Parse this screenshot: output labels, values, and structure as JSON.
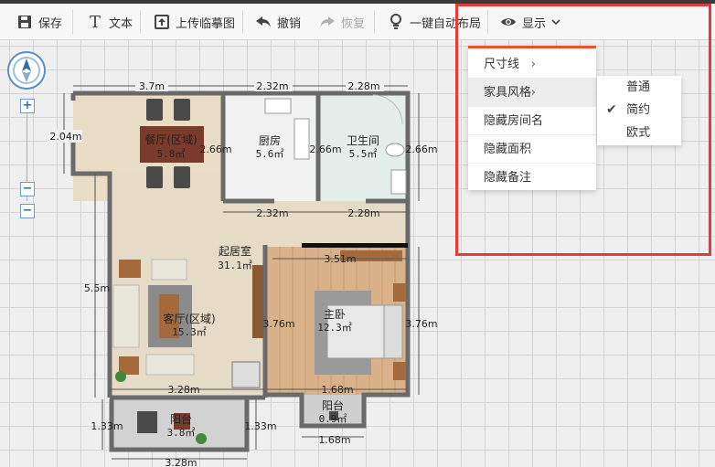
{
  "toolbar": {
    "save": "保存",
    "text": "文本",
    "upload": "上传临摹图",
    "undo": "撤销",
    "redo": "恢复",
    "auto_layout": "一键自动布局",
    "display": "显示"
  },
  "display_menu": {
    "items": [
      "尺寸线",
      "家具风格",
      "隐藏房间名",
      "隐藏面积",
      "隐藏备注"
    ],
    "style_submenu": [
      "普通",
      "简约",
      "欧式"
    ],
    "selected_style": "简约"
  },
  "rooms": [
    {
      "name": "餐厅(区域)",
      "area": "5.8㎡"
    },
    {
      "name": "厨房",
      "area": "5.6㎡"
    },
    {
      "name": "卫生间",
      "area": "5.5㎡"
    },
    {
      "name": "起居室",
      "area": "31.1㎡"
    },
    {
      "name": "客厅(区域)",
      "area": "15.3㎡"
    },
    {
      "name": "主卧",
      "area": "12.3㎡"
    },
    {
      "name": "阳台",
      "area": "0.9㎡"
    },
    {
      "name": "阳台",
      "area": "3.8㎡"
    }
  ],
  "dimensions": {
    "top_dining": "3.7m",
    "top_kitchen": "2.32m",
    "top_bath": "2.28m",
    "left_dining": "2.04m",
    "dining_kitchen": "2.66m",
    "kitchen_bath": "2.66m",
    "right_bath": "2.66m",
    "mid_kitchen": "2.32m",
    "mid_bath": "2.28m",
    "bedroom_top": "3.51m",
    "left_main": "5.5m",
    "living_bedroom": "3.76m",
    "right_bedroom": "3.76m",
    "bottom_living": "3.28m",
    "bottom_bedroom": "1.68m",
    "balcony_left": "1.33m",
    "balcony_right": "1.33m",
    "small_balcony_bottom": "1.68m",
    "bottom_balcony": "3.28m"
  }
}
